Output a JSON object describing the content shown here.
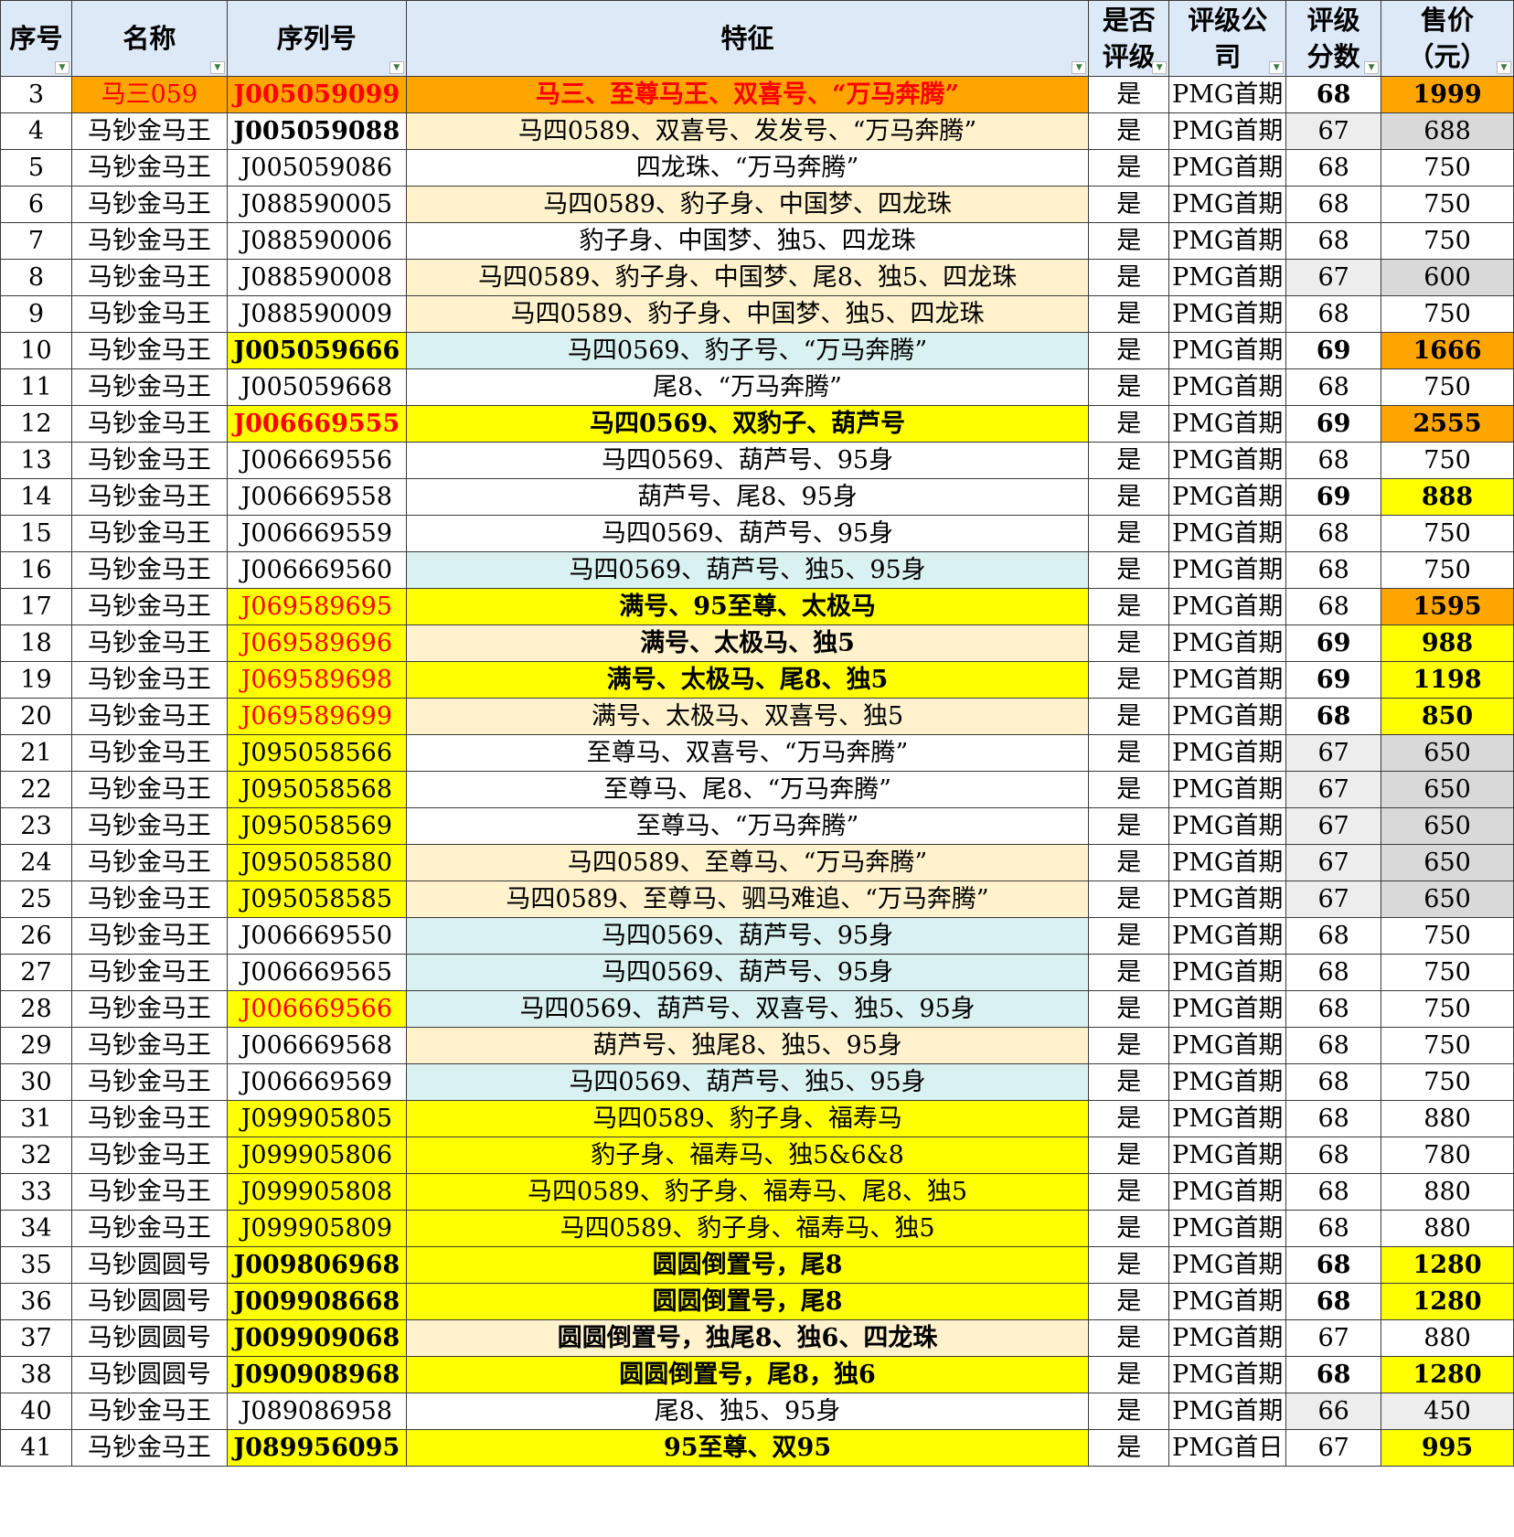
{
  "headers": [
    {
      "key": "idx",
      "lines": [
        "序号"
      ]
    },
    {
      "key": "name",
      "lines": [
        "名称"
      ]
    },
    {
      "key": "sn",
      "lines": [
        "序列号"
      ]
    },
    {
      "key": "feat",
      "lines": [
        "特征"
      ]
    },
    {
      "key": "grd",
      "lines": [
        "是否",
        "评级"
      ]
    },
    {
      "key": "co",
      "lines": [
        "评级公",
        "司"
      ]
    },
    {
      "key": "score",
      "lines": [
        "评级",
        "分数"
      ]
    },
    {
      "key": "price",
      "lines": [
        "售价",
        "（元）"
      ]
    }
  ],
  "filter_glyph": "▼",
  "rows": [
    {
      "idx": "3",
      "name": "马三059",
      "sn": "J005059099",
      "feat": "马三、至尊马王、双喜号、“万马奔腾”",
      "grd": "是",
      "co": "PMG首期",
      "score": "68",
      "price": "1999"
    },
    {
      "idx": "4",
      "name": "马钞金马王",
      "sn": "J005059088",
      "feat": "马四0589、双喜号、发发号、“万马奔腾”",
      "grd": "是",
      "co": "PMG首期",
      "score": "67",
      "price": "688"
    },
    {
      "idx": "5",
      "name": "马钞金马王",
      "sn": "J005059086",
      "feat": "四龙珠、“万马奔腾”",
      "grd": "是",
      "co": "PMG首期",
      "score": "68",
      "price": "750"
    },
    {
      "idx": "6",
      "name": "马钞金马王",
      "sn": "J088590005",
      "feat": "马四0589、豹子身、中国梦、四龙珠",
      "grd": "是",
      "co": "PMG首期",
      "score": "68",
      "price": "750"
    },
    {
      "idx": "7",
      "name": "马钞金马王",
      "sn": "J088590006",
      "feat": "豹子身、中国梦、独5、四龙珠",
      "grd": "是",
      "co": "PMG首期",
      "score": "68",
      "price": "750"
    },
    {
      "idx": "8",
      "name": "马钞金马王",
      "sn": "J088590008",
      "feat": "马四0589、豹子身、中国梦、尾8、独5、四龙珠",
      "grd": "是",
      "co": "PMG首期",
      "score": "67",
      "price": "600"
    },
    {
      "idx": "9",
      "name": "马钞金马王",
      "sn": "J088590009",
      "feat": "马四0589、豹子身、中国梦、独5、四龙珠",
      "grd": "是",
      "co": "PMG首期",
      "score": "68",
      "price": "750"
    },
    {
      "idx": "10",
      "name": "马钞金马王",
      "sn": "J005059666",
      "feat": "马四0569、豹子号、“万马奔腾”",
      "grd": "是",
      "co": "PMG首期",
      "score": "69",
      "price": "1666"
    },
    {
      "idx": "11",
      "name": "马钞金马王",
      "sn": "J005059668",
      "feat": "尾8、“万马奔腾”",
      "grd": "是",
      "co": "PMG首期",
      "score": "68",
      "price": "750"
    },
    {
      "idx": "12",
      "name": "马钞金马王",
      "sn": "J006669555",
      "feat": "马四0569、双豹子、葫芦号",
      "grd": "是",
      "co": "PMG首期",
      "score": "69",
      "price": "2555"
    },
    {
      "idx": "13",
      "name": "马钞金马王",
      "sn": "J006669556",
      "feat": "马四0569、葫芦号、95身",
      "grd": "是",
      "co": "PMG首期",
      "score": "68",
      "price": "750"
    },
    {
      "idx": "14",
      "name": "马钞金马王",
      "sn": "J006669558",
      "feat": "葫芦号、尾8、95身",
      "grd": "是",
      "co": "PMG首期",
      "score": "69",
      "price": "888"
    },
    {
      "idx": "15",
      "name": "马钞金马王",
      "sn": "J006669559",
      "feat": "马四0569、葫芦号、95身",
      "grd": "是",
      "co": "PMG首期",
      "score": "68",
      "price": "750"
    },
    {
      "idx": "16",
      "name": "马钞金马王",
      "sn": "J006669560",
      "feat": "马四0569、葫芦号、独5、95身",
      "grd": "是",
      "co": "PMG首期",
      "score": "68",
      "price": "750"
    },
    {
      "idx": "17",
      "name": "马钞金马王",
      "sn": "J069589695",
      "feat": "满号、95至尊、太极马",
      "grd": "是",
      "co": "PMG首期",
      "score": "68",
      "price": "1595"
    },
    {
      "idx": "18",
      "name": "马钞金马王",
      "sn": "J069589696",
      "feat": "满号、太极马、独5",
      "grd": "是",
      "co": "PMG首期",
      "score": "69",
      "price": "988"
    },
    {
      "idx": "19",
      "name": "马钞金马王",
      "sn": "J069589698",
      "feat": "满号、太极马、尾8、独5",
      "grd": "是",
      "co": "PMG首期",
      "score": "69",
      "price": "1198"
    },
    {
      "idx": "20",
      "name": "马钞金马王",
      "sn": "J069589699",
      "feat": "满号、太极马、双喜号、独5",
      "grd": "是",
      "co": "PMG首期",
      "score": "68",
      "price": "850"
    },
    {
      "idx": "21",
      "name": "马钞金马王",
      "sn": "J095058566",
      "feat": "至尊马、双喜号、“万马奔腾”",
      "grd": "是",
      "co": "PMG首期",
      "score": "67",
      "price": "650"
    },
    {
      "idx": "22",
      "name": "马钞金马王",
      "sn": "J095058568",
      "feat": "至尊马、尾8、“万马奔腾”",
      "grd": "是",
      "co": "PMG首期",
      "score": "67",
      "price": "650"
    },
    {
      "idx": "23",
      "name": "马钞金马王",
      "sn": "J095058569",
      "feat": "至尊马、“万马奔腾”",
      "grd": "是",
      "co": "PMG首期",
      "score": "67",
      "price": "650"
    },
    {
      "idx": "24",
      "name": "马钞金马王",
      "sn": "J095058580",
      "feat": "马四0589、至尊马、“万马奔腾”",
      "grd": "是",
      "co": "PMG首期",
      "score": "67",
      "price": "650"
    },
    {
      "idx": "25",
      "name": "马钞金马王",
      "sn": "J095058585",
      "feat": "马四0589、至尊马、驷马难追、“万马奔腾”",
      "grd": "是",
      "co": "PMG首期",
      "score": "67",
      "price": "650"
    },
    {
      "idx": "26",
      "name": "马钞金马王",
      "sn": "J006669550",
      "feat": "马四0569、葫芦号、95身",
      "grd": "是",
      "co": "PMG首期",
      "score": "68",
      "price": "750"
    },
    {
      "idx": "27",
      "name": "马钞金马王",
      "sn": "J006669565",
      "feat": "马四0569、葫芦号、95身",
      "grd": "是",
      "co": "PMG首期",
      "score": "68",
      "price": "750"
    },
    {
      "idx": "28",
      "name": "马钞金马王",
      "sn": "J006669566",
      "feat": "马四0569、葫芦号、双喜号、独5、95身",
      "grd": "是",
      "co": "PMG首期",
      "score": "68",
      "price": "750"
    },
    {
      "idx": "29",
      "name": "马钞金马王",
      "sn": "J006669568",
      "feat": "葫芦号、独尾8、独5、95身",
      "grd": "是",
      "co": "PMG首期",
      "score": "68",
      "price": "750"
    },
    {
      "idx": "30",
      "name": "马钞金马王",
      "sn": "J006669569",
      "feat": "马四0569、葫芦号、独5、95身",
      "grd": "是",
      "co": "PMG首期",
      "score": "68",
      "price": "750"
    },
    {
      "idx": "31",
      "name": "马钞金马王",
      "sn": "J099905805",
      "feat": "马四0589、豹子身、福寿马",
      "grd": "是",
      "co": "PMG首期",
      "score": "68",
      "price": "880"
    },
    {
      "idx": "32",
      "name": "马钞金马王",
      "sn": "J099905806",
      "feat": "豹子身、福寿马、独5&6&8",
      "grd": "是",
      "co": "PMG首期",
      "score": "68",
      "price": "780"
    },
    {
      "idx": "33",
      "name": "马钞金马王",
      "sn": "J099905808",
      "feat": "马四0589、豹子身、福寿马、尾8、独5",
      "grd": "是",
      "co": "PMG首期",
      "score": "68",
      "price": "880"
    },
    {
      "idx": "34",
      "name": "马钞金马王",
      "sn": "J099905809",
      "feat": "马四0589、豹子身、福寿马、独5",
      "grd": "是",
      "co": "PMG首期",
      "score": "68",
      "price": "880"
    },
    {
      "idx": "35",
      "name": "马钞圆圆号",
      "sn": "J009806968",
      "feat": "圆圆倒置号，尾8",
      "grd": "是",
      "co": "PMG首期",
      "score": "68",
      "price": "1280"
    },
    {
      "idx": "36",
      "name": "马钞圆圆号",
      "sn": "J009908668",
      "feat": "圆圆倒置号，尾8",
      "grd": "是",
      "co": "PMG首期",
      "score": "68",
      "price": "1280"
    },
    {
      "idx": "37",
      "name": "马钞圆圆号",
      "sn": "J009909068",
      "feat": "圆圆倒置号，独尾8、独6、四龙珠",
      "grd": "是",
      "co": "PMG首期",
      "score": "67",
      "price": "880"
    },
    {
      "idx": "38",
      "name": "马钞圆圆号",
      "sn": "J090908968",
      "feat": "圆圆倒置号，尾8，独6",
      "grd": "是",
      "co": "PMG首期",
      "score": "68",
      "price": "1280"
    },
    {
      "idx": "40",
      "name": "马钞金马王",
      "sn": "J089086958",
      "feat": "尾8、独5、95身",
      "grd": "是",
      "co": "PMG首期",
      "score": "66",
      "price": "450"
    },
    {
      "idx": "41",
      "name": "马钞金马王",
      "sn": "J089956095",
      "feat": "95至尊、双95",
      "grd": "是",
      "co": "PMG首日",
      "score": "67",
      "price": "995"
    }
  ],
  "colors": {
    "header_bg": "#dde9f7",
    "orange": "#ffa500",
    "peach": "#fff2cc",
    "cyan": "#daf1f1",
    "yellow": "#ffff00",
    "gray": "#d9d9d9",
    "light_gray": "#ededed",
    "red_text": "#ff0000"
  }
}
